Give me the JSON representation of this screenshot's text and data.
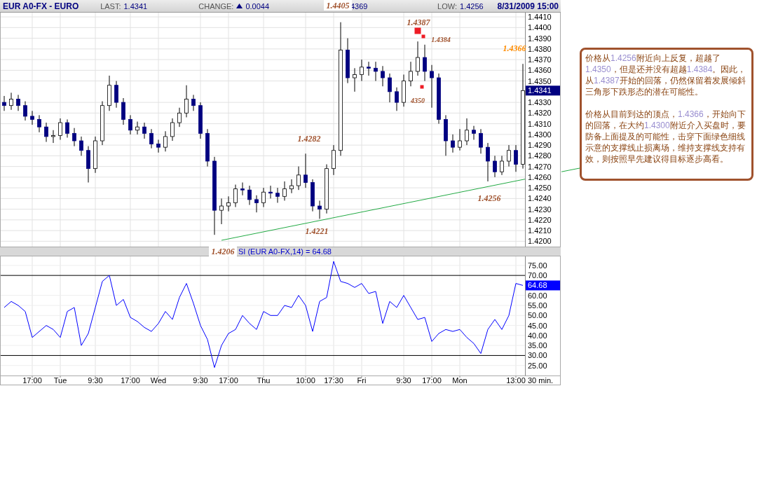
{
  "header": {
    "symbol": "EUR A0-FX - EURO",
    "last_label": "LAST:",
    "last": "1.4341",
    "change_label": "CHANGE:",
    "change": "0.0044",
    "high_partial": "4369",
    "low_label": "LOW:",
    "low": "1.4256",
    "datetime": "8/31/2009 15:00"
  },
  "price_chart": {
    "current_label": "1.4341",
    "chart_data": {
      "type": "candlestick",
      "grid": true,
      "ylim": [
        1.4195,
        1.4414
      ],
      "yticks": [
        {
          "value": 1.42,
          "label": "1.4200"
        },
        {
          "value": 1.421,
          "label": "1.4210"
        },
        {
          "value": 1.422,
          "label": "1.4220"
        },
        {
          "value": 1.423,
          "label": "1.4230"
        },
        {
          "value": 1.424,
          "label": "1.4240"
        },
        {
          "value": 1.425,
          "label": "1.4250"
        },
        {
          "value": 1.426,
          "label": "1.4260"
        },
        {
          "value": 1.427,
          "label": "1.4270"
        },
        {
          "value": 1.428,
          "label": "1.4280"
        },
        {
          "value": 1.429,
          "label": "1.4290"
        },
        {
          "value": 1.43,
          "label": "1.4300"
        },
        {
          "value": 1.431,
          "label": "1.4310"
        },
        {
          "value": 1.432,
          "label": "1.4320"
        },
        {
          "value": 1.433,
          "label": "1.4330"
        },
        {
          "value": 1.435,
          "label": "1.4350"
        },
        {
          "value": 1.436,
          "label": "1.4360"
        },
        {
          "value": 1.437,
          "label": "1.4370"
        },
        {
          "value": 1.438,
          "label": "1.4380"
        },
        {
          "value": 1.439,
          "label": "1.4390"
        },
        {
          "value": 1.44,
          "label": "1.4400"
        },
        {
          "value": 1.441,
          "label": "1.4410"
        }
      ],
      "ohlc": [
        [
          1.433,
          1.4336,
          1.4322,
          1.4327
        ],
        [
          1.4327,
          1.4339,
          1.4323,
          1.4333
        ],
        [
          1.4333,
          1.4337,
          1.4322,
          1.4327
        ],
        [
          1.4327,
          1.4331,
          1.4313,
          1.4317
        ],
        [
          1.4317,
          1.4322,
          1.4309,
          1.4314
        ],
        [
          1.4314,
          1.4318,
          1.4302,
          1.4307
        ],
        [
          1.4307,
          1.4311,
          1.4293,
          1.4298
        ],
        [
          1.4298,
          1.4304,
          1.4292,
          1.4299
        ],
        [
          1.4299,
          1.4315,
          1.4295,
          1.4311
        ],
        [
          1.4311,
          1.4314,
          1.4297,
          1.4301
        ],
        [
          1.4301,
          1.4306,
          1.4289,
          1.4294
        ],
        [
          1.4294,
          1.4298,
          1.428,
          1.4285
        ],
        [
          1.4285,
          1.4289,
          1.4255,
          1.4268
        ],
        [
          1.4268,
          1.4298,
          1.4264,
          1.4294
        ],
        [
          1.4294,
          1.4331,
          1.429,
          1.4327
        ],
        [
          1.4327,
          1.4355,
          1.4322,
          1.4346
        ],
        [
          1.4346,
          1.435,
          1.4325,
          1.433
        ],
        [
          1.433,
          1.4334,
          1.4309,
          1.4314
        ],
        [
          1.4314,
          1.4318,
          1.43,
          1.4304
        ],
        [
          1.4304,
          1.4312,
          1.43,
          1.4307
        ],
        [
          1.4307,
          1.4311,
          1.4296,
          1.4301
        ],
        [
          1.4301,
          1.4305,
          1.4287,
          1.4291
        ],
        [
          1.4291,
          1.4295,
          1.4283,
          1.4288
        ],
        [
          1.4288,
          1.4303,
          1.4284,
          1.4298
        ],
        [
          1.4298,
          1.4315,
          1.4294,
          1.4311
        ],
        [
          1.4311,
          1.4325,
          1.4307,
          1.432
        ],
        [
          1.432,
          1.4346,
          1.4316,
          1.4333
        ],
        [
          1.4333,
          1.4337,
          1.4322,
          1.4327
        ],
        [
          1.4327,
          1.433,
          1.4296,
          1.4301
        ],
        [
          1.4301,
          1.4305,
          1.427,
          1.4275
        ],
        [
          1.4275,
          1.4279,
          1.4206,
          1.4229
        ],
        [
          1.4229,
          1.424,
          1.4216,
          1.4233
        ],
        [
          1.4233,
          1.4242,
          1.4228,
          1.4236
        ],
        [
          1.4236,
          1.4253,
          1.4232,
          1.4249
        ],
        [
          1.4249,
          1.4255,
          1.4243,
          1.4248
        ],
        [
          1.4248,
          1.4252,
          1.4234,
          1.4239
        ],
        [
          1.4239,
          1.4243,
          1.4227,
          1.4236
        ],
        [
          1.4236,
          1.425,
          1.4232,
          1.4246
        ],
        [
          1.4246,
          1.4252,
          1.424,
          1.4245
        ],
        [
          1.4245,
          1.425,
          1.4236,
          1.4242
        ],
        [
          1.4242,
          1.4256,
          1.4238,
          1.4249
        ],
        [
          1.4249,
          1.4258,
          1.4245,
          1.4252
        ],
        [
          1.4252,
          1.427,
          1.4248,
          1.4262
        ],
        [
          1.4262,
          1.4282,
          1.425,
          1.4255
        ],
        [
          1.4255,
          1.4258,
          1.4228,
          1.4233
        ],
        [
          1.4233,
          1.4238,
          1.4221,
          1.423
        ],
        [
          1.423,
          1.4272,
          1.4226,
          1.4268
        ],
        [
          1.4268,
          1.429,
          1.4262,
          1.4285
        ],
        [
          1.4285,
          1.4405,
          1.428,
          1.4379
        ],
        [
          1.4379,
          1.439,
          1.4348,
          1.4353
        ],
        [
          1.4353,
          1.4362,
          1.434,
          1.4356
        ],
        [
          1.4356,
          1.437,
          1.435,
          1.4363
        ],
        [
          1.4363,
          1.4368,
          1.4355,
          1.4362
        ],
        [
          1.4362,
          1.4368,
          1.435,
          1.4359
        ],
        [
          1.4359,
          1.4364,
          1.4345,
          1.4353
        ],
        [
          1.4353,
          1.4357,
          1.433,
          1.434
        ],
        [
          1.434,
          1.4344,
          1.4322,
          1.433
        ],
        [
          1.433,
          1.4356,
          1.4326,
          1.435
        ],
        [
          1.435,
          1.4368,
          1.4345,
          1.4359
        ],
        [
          1.4359,
          1.4387,
          1.4355,
          1.4372
        ],
        [
          1.4372,
          1.4384,
          1.435,
          1.4359
        ],
        [
          1.4359,
          1.4365,
          1.4325,
          1.4353
        ],
        [
          1.4353,
          1.4357,
          1.431,
          1.4314
        ],
        [
          1.4314,
          1.4318,
          1.428,
          1.4294
        ],
        [
          1.4294,
          1.43,
          1.4283,
          1.4288
        ],
        [
          1.4288,
          1.4305,
          1.4285,
          1.4294
        ],
        [
          1.4294,
          1.4315,
          1.429,
          1.4304
        ],
        [
          1.4304,
          1.4308,
          1.4295,
          1.4301
        ],
        [
          1.4301,
          1.4305,
          1.4282,
          1.4288
        ],
        [
          1.4288,
          1.4292,
          1.4256,
          1.4275
        ],
        [
          1.4275,
          1.428,
          1.426,
          1.4265
        ],
        [
          1.4265,
          1.428,
          1.4262,
          1.4275
        ],
        [
          1.4275,
          1.429,
          1.427,
          1.4285
        ],
        [
          1.4285,
          1.429,
          1.4265,
          1.4272
        ],
        [
          1.4272,
          1.4366,
          1.4268,
          1.4341
        ]
      ],
      "annotations": [
        "1.4405",
        "1.4387",
        "1.4384",
        "1.4366",
        "4350",
        "1.4282",
        "1.4256",
        "1.4221",
        "1.4206"
      ]
    }
  },
  "rsi_panel": {
    "title": "SI (EUR A0-FX,14) = 64.68",
    "current_label": "64.68",
    "chart_data": {
      "type": "line",
      "grid": true,
      "xlabel": "30 min.",
      "ylim": [
        20,
        79.5
      ],
      "yticks": [
        {
          "value": 25,
          "label": "25.00"
        },
        {
          "value": 30,
          "label": "30.00"
        },
        {
          "value": 35,
          "label": "35.00"
        },
        {
          "value": 40,
          "label": "40.00"
        },
        {
          "value": 45,
          "label": "45.00"
        },
        {
          "value": 50,
          "label": "50.00"
        },
        {
          "value": 55,
          "label": "55.00"
        },
        {
          "value": 60,
          "label": "60.00"
        },
        {
          "value": 70,
          "label": "70.00"
        },
        {
          "value": 75,
          "label": "75.00"
        }
      ],
      "categories": [
        null,
        null,
        null,
        null,
        "17:00",
        null,
        null,
        null,
        "Tue",
        null,
        null,
        null,
        null,
        "9:30",
        null,
        null,
        null,
        null,
        "17:00",
        null,
        null,
        null,
        "Wed",
        null,
        null,
        null,
        null,
        null,
        "9:30",
        null,
        null,
        null,
        "17:00",
        null,
        null,
        null,
        null,
        "Thu",
        null,
        null,
        null,
        null,
        null,
        "10:00",
        null,
        null,
        null,
        "17:30",
        null,
        null,
        null,
        "Fri",
        null,
        null,
        null,
        null,
        null,
        "9:30",
        null,
        null,
        null,
        "17:00",
        null,
        null,
        null,
        "Mon",
        null,
        null,
        null,
        null,
        null,
        null,
        null,
        "13:00",
        null
      ],
      "series": [
        {
          "color": "#0000ff",
          "values": [
            54,
            57,
            55,
            52,
            39,
            42,
            45,
            43,
            39,
            52,
            54,
            35,
            41,
            54,
            67,
            70,
            55,
            58,
            49,
            47,
            44,
            42,
            46,
            52,
            48,
            59,
            66,
            56,
            45,
            38,
            24,
            35,
            41,
            43,
            50,
            46,
            43,
            52,
            50,
            50,
            55,
            54,
            60,
            55,
            42,
            57,
            59,
            77,
            67,
            66,
            64,
            66,
            61,
            62,
            46,
            57,
            54,
            60,
            54,
            48,
            49,
            37,
            41,
            43,
            42,
            43,
            39,
            36,
            31,
            43,
            48,
            43,
            50,
            66,
            65
          ]
        }
      ]
    }
  },
  "note": {
    "paragraphs": [
      {
        "segments": [
          {
            "text": "价格从",
            "highlight": false
          },
          {
            "text": "1.4256",
            "highlight": true
          },
          {
            "text": "附近向上反复，超越了",
            "highlight": false
          },
          {
            "text": "1.4350",
            "highlight": true
          },
          {
            "text": "，但是还并没有超越",
            "highlight": false
          },
          {
            "text": "1.4384",
            "highlight": true
          },
          {
            "text": "。因此，从",
            "highlight": false
          },
          {
            "text": "1.4387",
            "highlight": true
          },
          {
            "text": "开始的回落，仍然保留着发展倾斜三角形下跌形态的潜在可能性。",
            "highlight": false
          }
        ]
      },
      {
        "segments": [
          {
            "text": "价格从目前到达的顶点，",
            "highlight": false
          },
          {
            "text": "1.4366",
            "highlight": true
          },
          {
            "text": "，开始向下的回落，在大约",
            "highlight": false
          },
          {
            "text": "1.4300",
            "highlight": true
          },
          {
            "text": "附近介入买盘时，要防备上面提及的可能性，击穿下面绿色细线示意的支撑线止损离场，维持支撑线支持有效，则按照早先建议得目标逐步高看。",
            "highlight": false
          }
        ]
      }
    ]
  }
}
